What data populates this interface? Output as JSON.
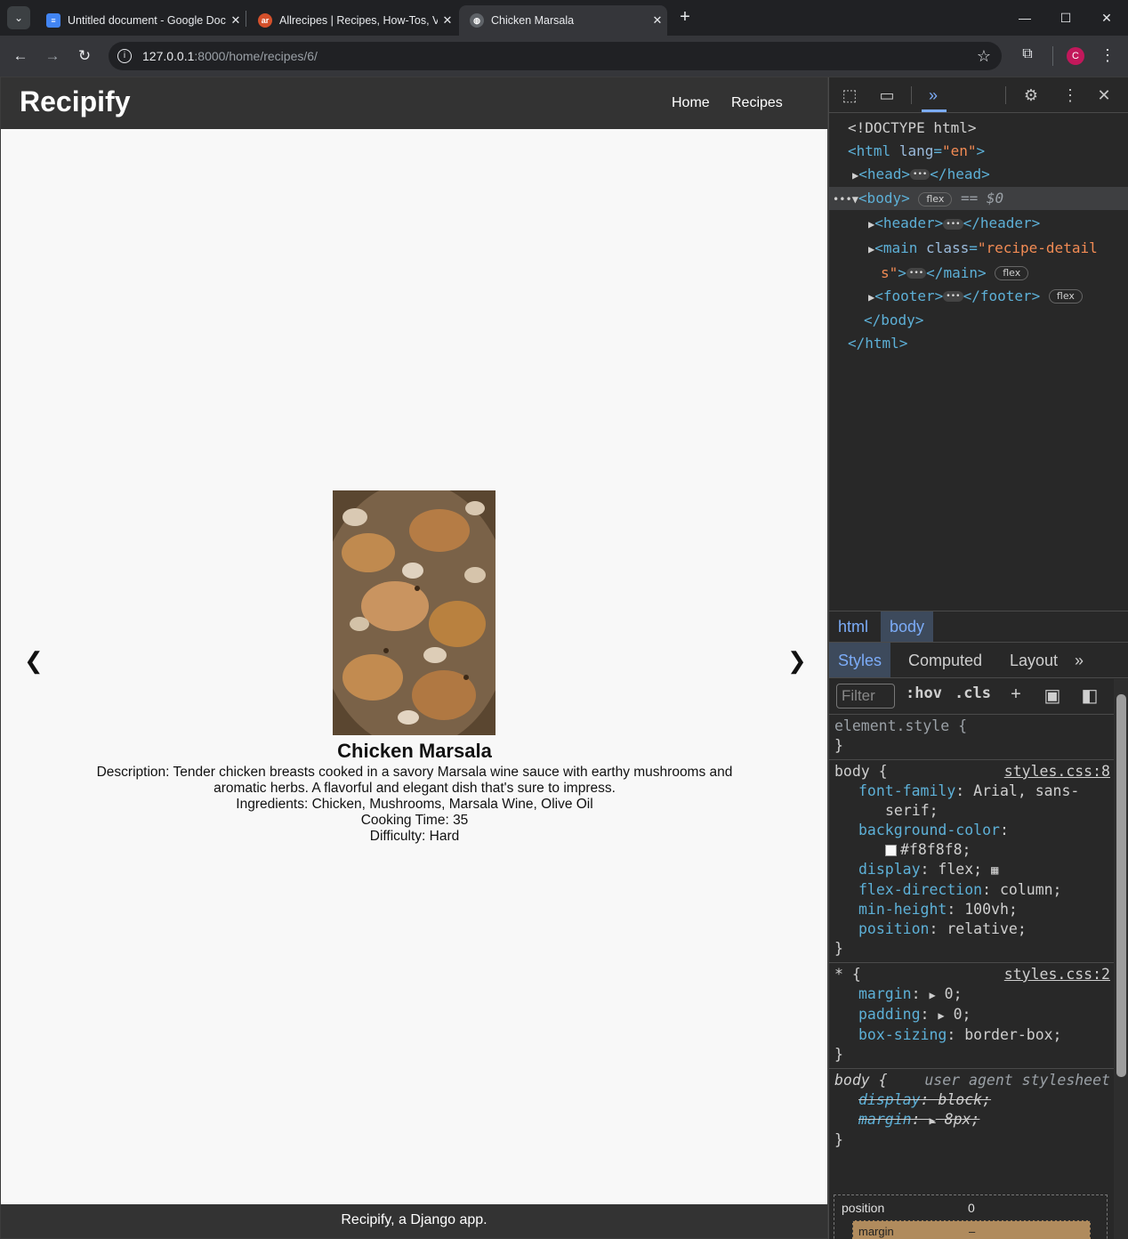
{
  "browser": {
    "tabs": [
      {
        "title": "Untitled document - Google Docs",
        "icon": "google-docs-icon",
        "color": "#4285f4",
        "active": false
      },
      {
        "title": "Allrecipes | Recipes, How-Tos, Videos and More",
        "icon": "allrecipes-icon",
        "color": "#d4502b",
        "active": false
      },
      {
        "title": "Chicken Marsala",
        "icon": "globe-icon",
        "color": "#9aa0a6",
        "active": true
      }
    ],
    "url_host": "127.0.0.1",
    "url_path": ":8000/home/recipes/6/",
    "profile_initial": "C"
  },
  "site": {
    "brand": "Recipify",
    "nav": [
      "Home",
      "Recipes"
    ],
    "footer": "Recipify, a Django app."
  },
  "recipe": {
    "title": "Chicken Marsala",
    "description": "Description: Tender chicken breasts cooked in a savory Marsala wine sauce with earthy mushrooms and aromatic herbs. A flavorful and elegant dish that's sure to impress.",
    "ingredients": "Ingredients: Chicken, Mushrooms, Marsala Wine, Olive Oil",
    "cooking_time": "Cooking Time: 35",
    "difficulty": "Difficulty: Hard",
    "prev": "❮",
    "next": "❯"
  },
  "devtools": {
    "tree": {
      "doctype": "<!DOCTYPE html>",
      "html_open": "<html",
      "lang_attr": "lang",
      "lang_val": "\"en\"",
      "head": "<head>",
      "head_close": "</head>",
      "body": "<body>",
      "body_badge": "flex",
      "eq": "== $0",
      "header": "<header>",
      "header_close": "</header>",
      "main_open": "<main",
      "main_attr": "class",
      "main_val_1": "\"recipe-detail",
      "main_val_2": "s\"",
      "main_close": "</main>",
      "main_badge": "flex",
      "footer": "<footer>",
      "footer_close": "</footer>",
      "footer_badge": "flex",
      "body_close": "</body>",
      "html_close": "</html>"
    },
    "breadcrumbs": [
      "html",
      "body"
    ],
    "panel_tabs": [
      "Styles",
      "Computed",
      "Layout"
    ],
    "filter_placeholder": "Filter",
    "hov": ":hov",
    "cls": ".cls",
    "rules": {
      "element_style": "element.style {",
      "body_selector": "body {",
      "body_source": "styles.css:8",
      "font_family": "Arial, sans-",
      "font_family_2": "serif;",
      "background_color": "#f8f8f8;",
      "display": "flex;",
      "flex_direction": "column;",
      "min_height": "100vh;",
      "position": "relative;",
      "star_selector": "* {",
      "star_source": "styles.css:2",
      "margin": "0;",
      "padding": "0;",
      "box_sizing": "border-box;",
      "ua_selector": "body {",
      "ua_source": "user agent stylesheet",
      "ua_display": "block;",
      "ua_margin": "8px;"
    },
    "box_model": {
      "position_label": "position",
      "position_value": "0",
      "margin_label": "margin",
      "margin_value": "–"
    }
  }
}
